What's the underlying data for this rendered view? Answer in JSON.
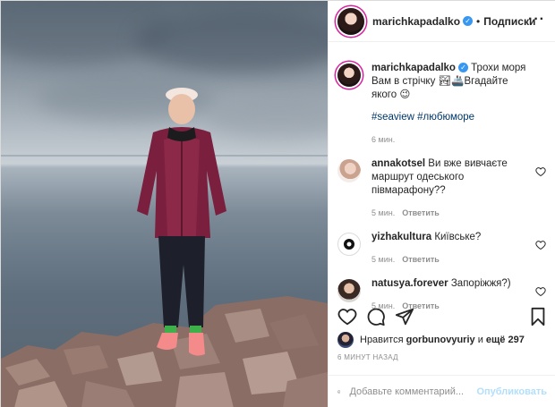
{
  "post": {
    "author": "marichkapadalko",
    "follow_label": "Подписки",
    "more_icon": "more-icon",
    "caption_user": "marichkapadalko",
    "caption_text": "Трохи моря Вам в стрічку 🏞🚢Вгадайте якого 😉",
    "hashtags": "#seaview #любюморе",
    "caption_time": "6 мин."
  },
  "comments": [
    {
      "user": "annakotsel",
      "text": "Ви вже вивчаєте маршрут одеського півмарафону??",
      "time": "5 мин.",
      "reply": "Ответить"
    },
    {
      "user": "yizhakultura",
      "text": "Київське?",
      "time": "5 мин.",
      "reply": "Ответить"
    },
    {
      "user": "natusya.forever",
      "text": "Запоріжжя?)",
      "time": "5 мин.",
      "reply": "Ответить"
    }
  ],
  "likes": {
    "prefix": "Нравится",
    "user": "gorbunovyuriy",
    "and": "и",
    "others": "ещё 297"
  },
  "timestamp": "6 МИНУТ НАЗАД",
  "add_comment": {
    "placeholder": "Добавьте комментарий...",
    "publish_label": "Опубликовать"
  },
  "colors": {
    "accent": "#3897f0",
    "link": "#00376b",
    "muted": "#8e8e8e",
    "publish_disabled": "#b2dffc"
  }
}
